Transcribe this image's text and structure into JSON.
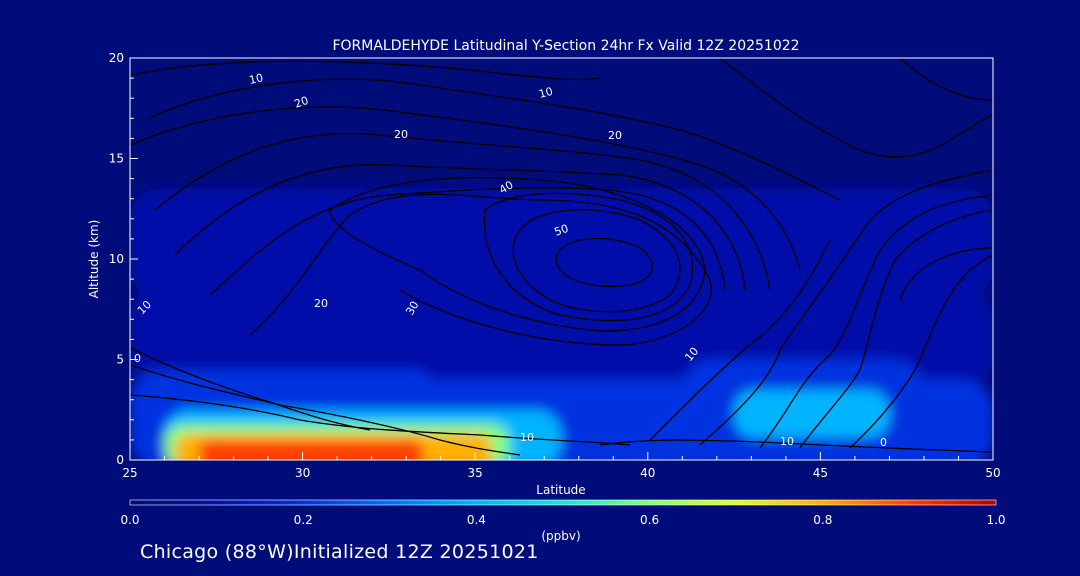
{
  "chart_data": {
    "type": "heatmap",
    "title": "FORMALDEHYDE Latitudinal Y-Section 24hr  Fx Valid 12Z 20251022",
    "xlabel": "Latitude",
    "ylabel": "Altitude (km)",
    "xlim": [
      25,
      50
    ],
    "ylim": [
      0,
      20
    ],
    "x_ticks": [
      "25",
      "30",
      "35",
      "40",
      "45",
      "50"
    ],
    "y_ticks": [
      "0",
      "5",
      "10",
      "15",
      "20"
    ],
    "x_tick_values": [
      25,
      30,
      35,
      40,
      45,
      50
    ],
    "y_tick_values": [
      0,
      5,
      10,
      15,
      20
    ],
    "colorbar": {
      "label": "(ppbv)",
      "min": 0.0,
      "max": 1.0,
      "ticks": [
        "0.0",
        "0.2",
        "0.4",
        "0.6",
        "0.8",
        "1.0"
      ],
      "tick_values": [
        0.0,
        0.2,
        0.4,
        0.6,
        0.8,
        1.0
      ]
    },
    "color_scale": [
      "#000c7a",
      "#0010a8",
      "#0030e0",
      "#0070ff",
      "#00b4ff",
      "#20e0e0",
      "#80ff80",
      "#e0ff20",
      "#ffb000",
      "#ff4000",
      "#b00000"
    ],
    "contour_labels": [
      "10",
      "20",
      "10",
      "20",
      "10",
      "20",
      "20",
      "30",
      "40",
      "50",
      "10",
      "0",
      "10",
      "10",
      "0"
    ],
    "grid": false,
    "colorbar_position": "bottom",
    "heatmap_regions": [
      {
        "lat": [
          25,
          50
        ],
        "alt": [
          8.5,
          13.5
        ],
        "value": 0.05
      },
      {
        "lat": [
          25,
          50
        ],
        "alt": [
          4,
          8.5
        ],
        "value": 0.1
      },
      {
        "lat": [
          25,
          50
        ],
        "alt": [
          0,
          4
        ],
        "value": 0.15
      },
      {
        "lat": [
          25,
          34
        ],
        "alt": [
          0,
          4.5
        ],
        "value": 0.22
      },
      {
        "lat": [
          41,
          48
        ],
        "alt": [
          0.8,
          5
        ],
        "value": 0.24
      },
      {
        "lat": [
          42.5,
          47
        ],
        "alt": [
          1.5,
          3.5
        ],
        "value": 0.36
      },
      {
        "lat": [
          26,
          37.5
        ],
        "alt": [
          0,
          2.5
        ],
        "value": 0.38
      },
      {
        "lat": [
          26,
          36
        ],
        "alt": [
          0,
          1.8
        ],
        "value": 0.55
      },
      {
        "lat": [
          26.3,
          35.5
        ],
        "alt": [
          0,
          1.3
        ],
        "value": 0.75
      },
      {
        "lat": [
          27,
          33.5
        ],
        "alt": [
          0,
          1.0
        ],
        "value": 0.92
      }
    ]
  },
  "footer": {
    "location": "Chicago (88°W)Initialized 12Z 20251021"
  }
}
